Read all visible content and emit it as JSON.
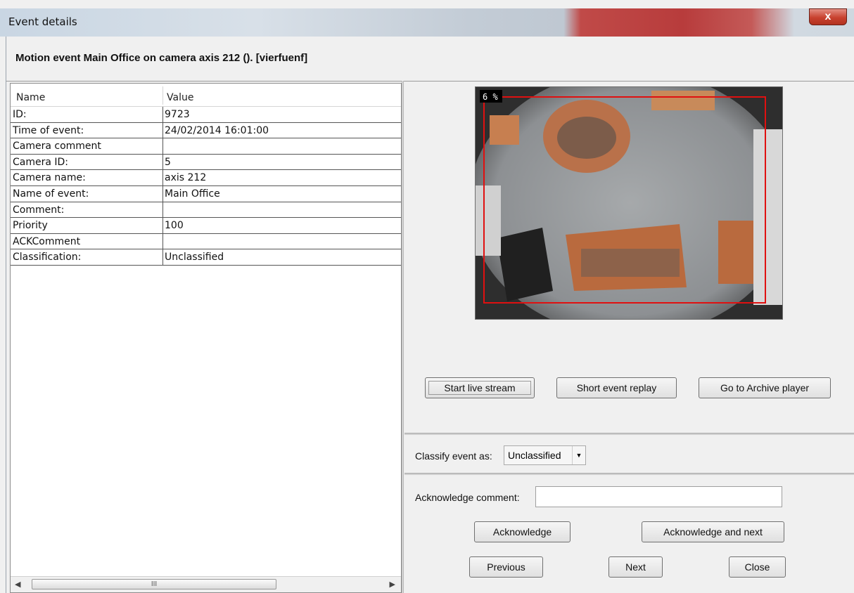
{
  "window": {
    "title": "Event details",
    "close_label": "x"
  },
  "header": {
    "title": "Motion event Main Office on camera axis 212 (). [vierfuenf]"
  },
  "table": {
    "columns": [
      "Name",
      "Value"
    ],
    "rows": [
      {
        "name": "ID:",
        "value": "9723"
      },
      {
        "name": "Time of event:",
        "value": "24/02/2014 16:01:00"
      },
      {
        "name": "Camera comment",
        "value": ""
      },
      {
        "name": "Camera ID:",
        "value": "5"
      },
      {
        "name": "Camera name:",
        "value": "axis 212"
      },
      {
        "name": "Name of event:",
        "value": "Main Office"
      },
      {
        "name": "Comment:",
        "value": ""
      },
      {
        "name": "Priority",
        "value": "100"
      },
      {
        "name": "ACKComment",
        "value": ""
      },
      {
        "name": "Classification:",
        "value": "Unclassified"
      }
    ],
    "scroll_thumb_glyph": "III"
  },
  "camera": {
    "overlay_label": "6 %"
  },
  "actions": {
    "start_live": "Start live stream",
    "short_replay": "Short event replay",
    "archive_player": "Go to Archive player"
  },
  "classify": {
    "label": "Classify event as:",
    "selected": "Unclassified"
  },
  "acknowledge": {
    "comment_label": "Acknowledge comment:",
    "comment_value": "",
    "ack_label": "Acknowledge",
    "ack_next_label": "Acknowledge and next",
    "previous_label": "Previous",
    "next_label": "Next",
    "close_label": "Close"
  },
  "colors": {
    "motion_box": "#e01010",
    "title_close": "#c8412f"
  }
}
